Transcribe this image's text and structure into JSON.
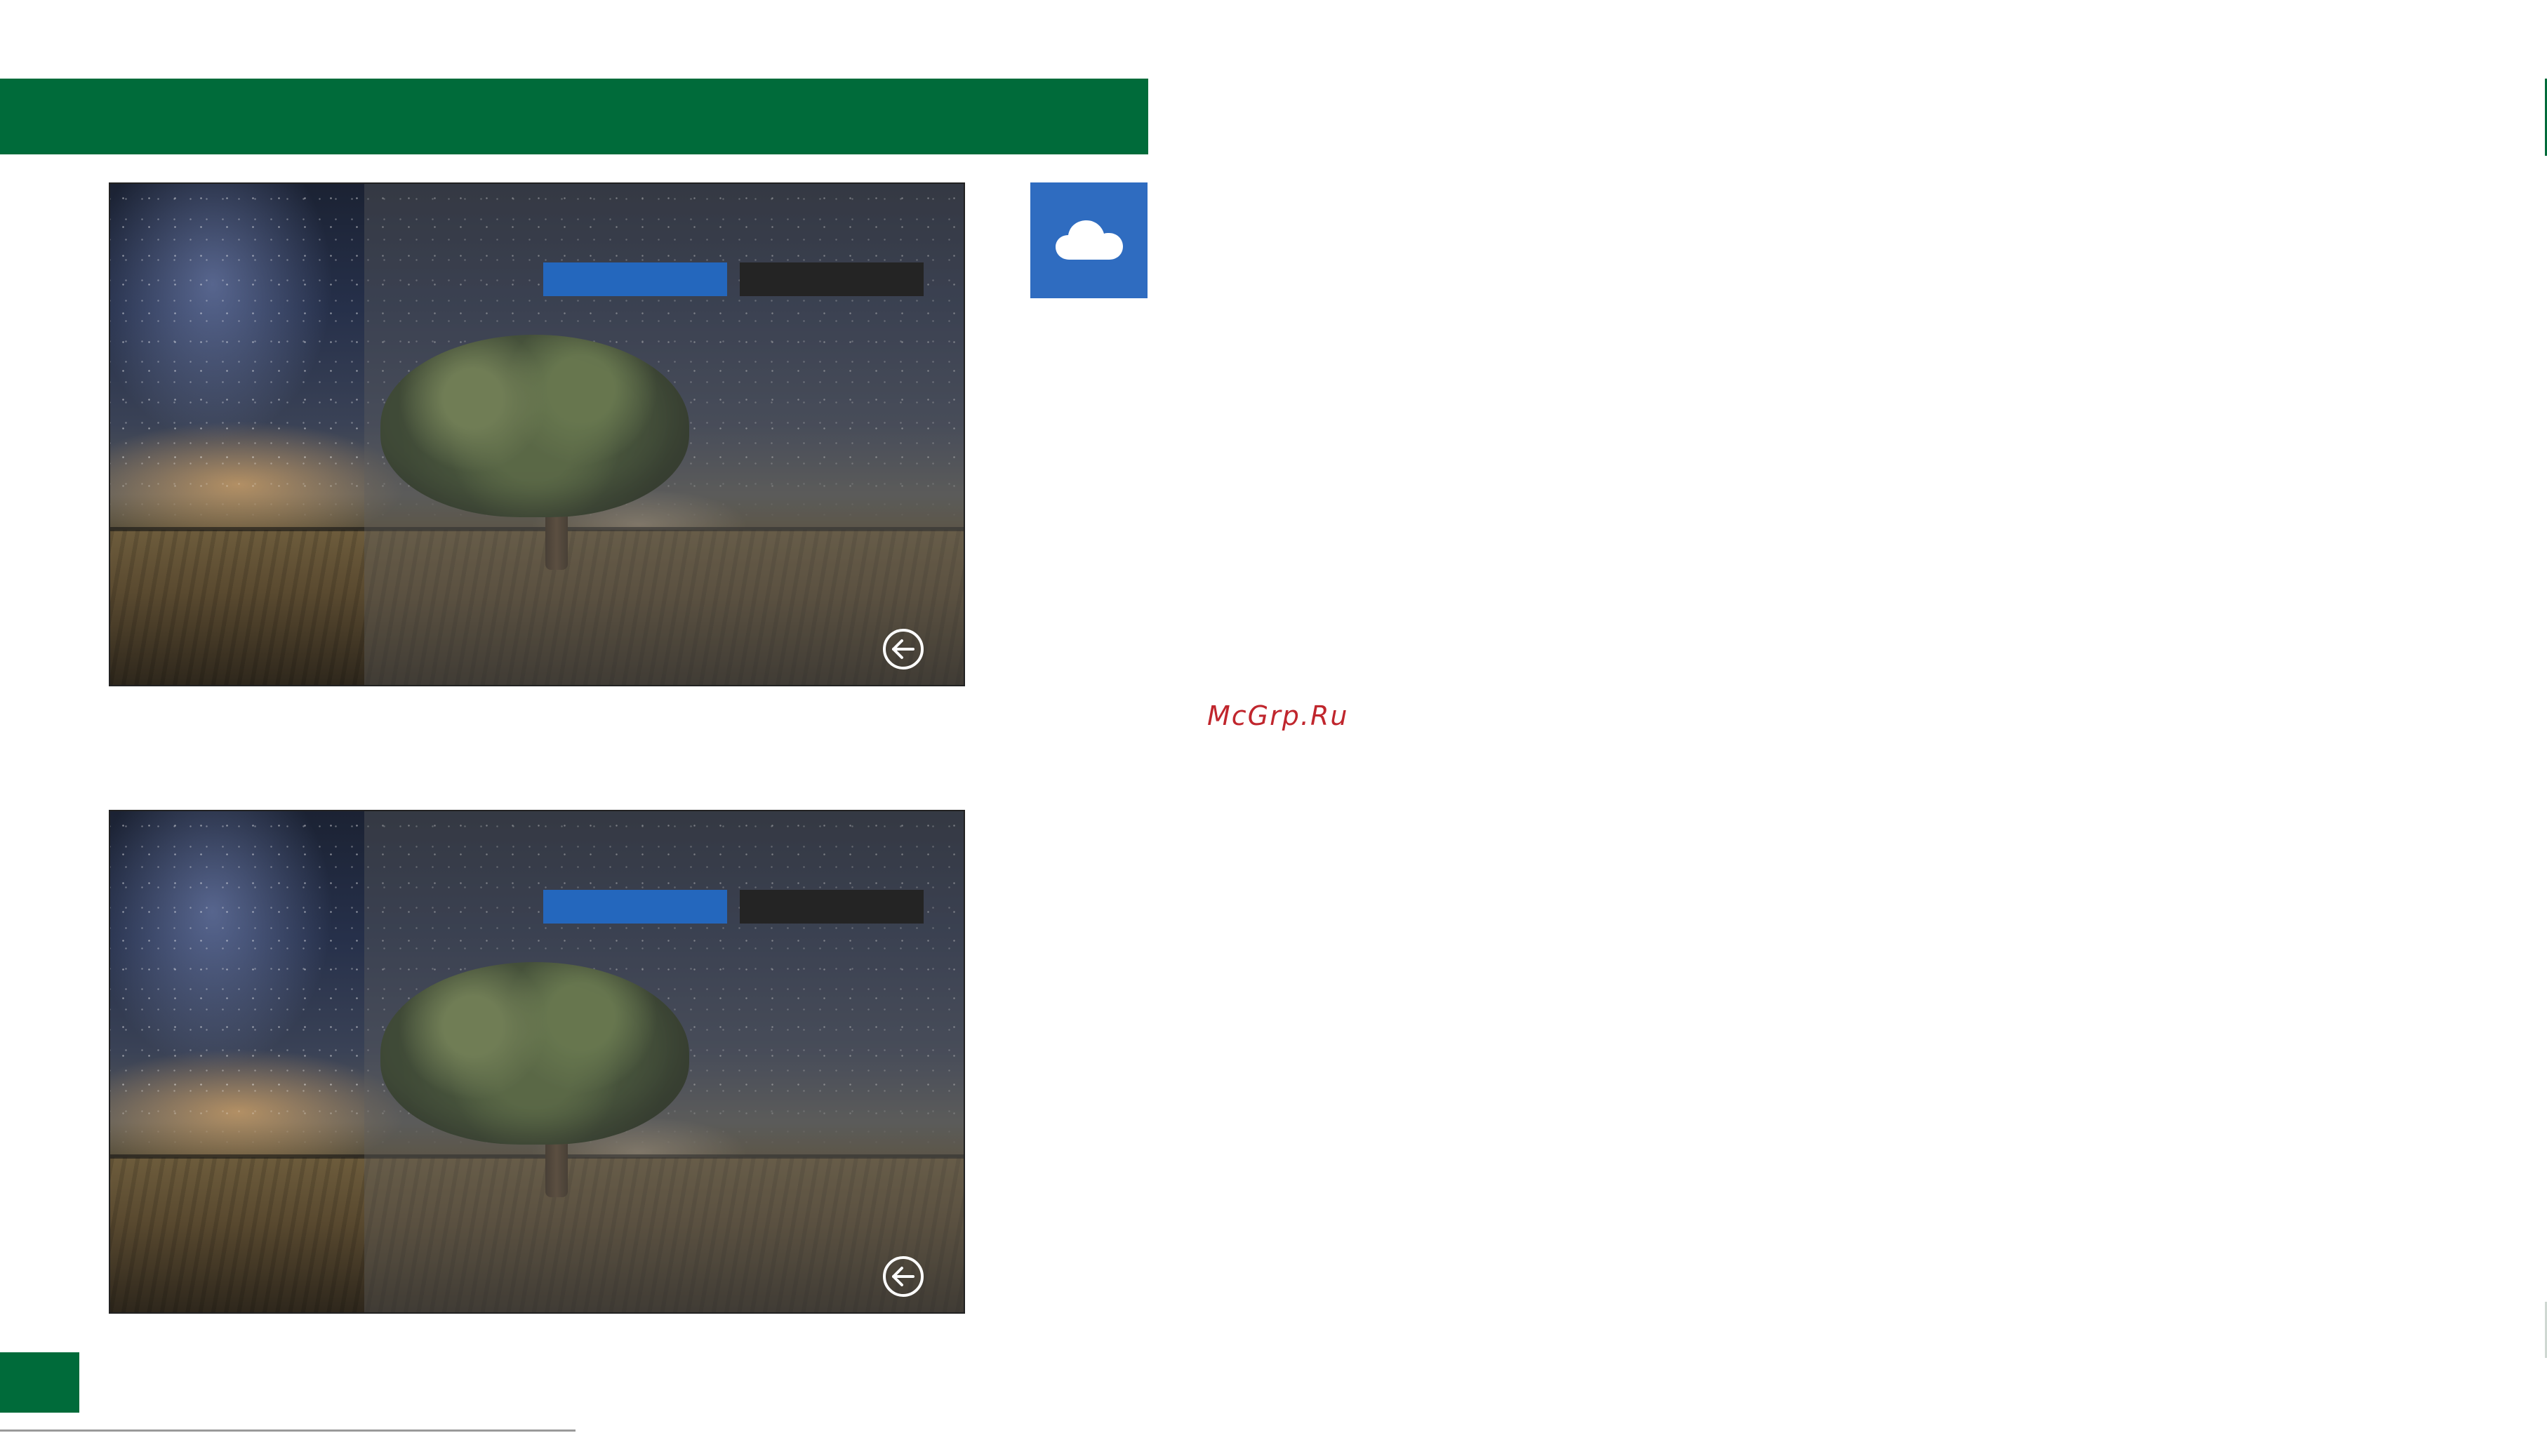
{
  "watermark": {
    "text": "McGrp.Ru"
  },
  "colors": {
    "brand_green": "#006b3a",
    "tile_blue": "#2f6cc0",
    "button_blue": "#2467bd",
    "button_dark": "#242424",
    "watermark_red": "#c0262d"
  },
  "icons": {
    "tile": "cloud-icon",
    "back": "back-arrow-icon"
  },
  "screens": [
    {
      "background": "night-sky-tree-field-photo"
    },
    {
      "background": "night-sky-tree-field-photo"
    }
  ]
}
